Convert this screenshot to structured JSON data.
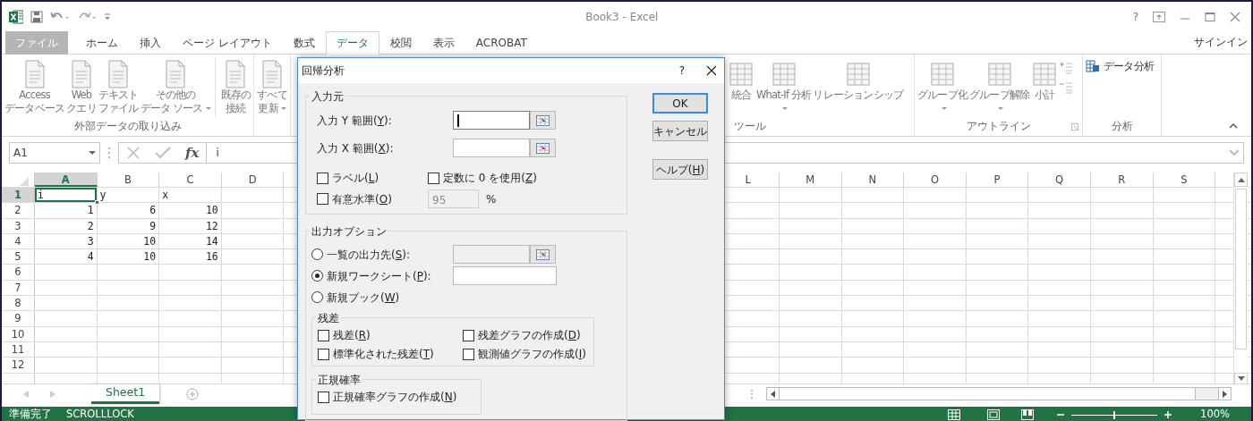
{
  "title_bar": {
    "title": "Book3 - Excel",
    "help": "?"
  },
  "ribbon_tabs": [
    {
      "label": "ファイル",
      "kind": "file",
      "selected": false
    },
    {
      "label": "ホーム",
      "kind": "tab",
      "selected": false
    },
    {
      "label": "挿入",
      "kind": "tab",
      "selected": false
    },
    {
      "label": "ページ レイアウト",
      "kind": "tab",
      "selected": false
    },
    {
      "label": "数式",
      "kind": "tab",
      "selected": false
    },
    {
      "label": "データ",
      "kind": "tab",
      "selected": true
    },
    {
      "label": "校閲",
      "kind": "tab",
      "selected": false
    },
    {
      "label": "表示",
      "kind": "tab",
      "selected": false
    },
    {
      "label": "ACROBAT",
      "kind": "tab",
      "selected": false
    }
  ],
  "account": "サインイン",
  "ribbon_groups": [
    {
      "label": "外部データの取り込み",
      "launcher": false,
      "buttons": [
        {
          "lines": [
            "Access",
            "データベース"
          ],
          "kind": "large",
          "dropdown": false,
          "separator_before": false
        },
        {
          "lines": [
            "Web",
            "クエリ"
          ],
          "kind": "large",
          "dropdown": false,
          "separator_before": false
        },
        {
          "lines": [
            "テキスト",
            "ファイル"
          ],
          "kind": "large",
          "dropdown": false,
          "separator_before": false
        },
        {
          "lines": [
            "その他の",
            "データ ソース"
          ],
          "kind": "large",
          "dropdown": true,
          "separator_before": false
        },
        {
          "lines": [
            "既存の",
            "接続"
          ],
          "kind": "large",
          "dropdown": false,
          "separator_before": true
        }
      ]
    },
    {
      "launcher": false,
      "buttons": [
        {
          "lines": [
            "すべて",
            "更新"
          ],
          "kind": "large",
          "dropdown": true,
          "separator_before": false
        }
      ]
    },
    {
      "label": "ツール",
      "launcher": false,
      "buttons": [
        {
          "lines": [
            "統合"
          ],
          "kind": "large",
          "dropdown": false,
          "separator_before": false
        },
        {
          "lines": [
            "What-If 分析"
          ],
          "kind": "large",
          "dropdown": true,
          "separator_before": false
        },
        {
          "lines": [
            "リレーションシップ"
          ],
          "kind": "large",
          "dropdown": false,
          "separator_before": false
        }
      ]
    },
    {
      "label": "アウトライン",
      "launcher": true,
      "buttons": [
        {
          "lines": [
            "グループ化"
          ],
          "kind": "large",
          "dropdown": true,
          "separator_before": false
        },
        {
          "lines": [
            "グループ解除"
          ],
          "kind": "large",
          "dropdown": true,
          "separator_before": false
        },
        {
          "lines": [
            "小計"
          ],
          "kind": "large",
          "dropdown": false,
          "separator_before": false
        },
        {
          "kind": "icon-stack"
        }
      ]
    },
    {
      "label": "分析",
      "launcher": false,
      "buttons": [
        {
          "lines": [
            "データ分析"
          ],
          "kind": "small",
          "dropdown": false,
          "separator_before": false
        }
      ]
    }
  ],
  "formula_bar": {
    "name_box": "A1",
    "fx": "fx",
    "formula": "i"
  },
  "columns": [
    {
      "label": "A",
      "selected": true
    },
    {
      "label": "B",
      "selected": false
    },
    {
      "label": "C",
      "selected": false
    },
    {
      "label": "D",
      "selected": false
    },
    {
      "label": "L",
      "selected": false
    },
    {
      "label": "M",
      "selected": false
    },
    {
      "label": "N",
      "selected": false
    },
    {
      "label": "O",
      "selected": false
    },
    {
      "label": "P",
      "selected": false
    },
    {
      "label": "Q",
      "selected": false
    },
    {
      "label": "R",
      "selected": false
    },
    {
      "label": "S",
      "selected": false
    }
  ],
  "rows": [
    {
      "header": "1",
      "selected": true,
      "cells": [
        {
          "text": "i",
          "kind": "text",
          "active": true
        },
        {
          "text": "y",
          "kind": "text",
          "active": false
        },
        {
          "text": "x",
          "kind": "text",
          "active": false
        }
      ]
    },
    {
      "header": "2",
      "selected": false,
      "cells": [
        {
          "text": "1",
          "kind": "number",
          "active": false
        },
        {
          "text": "6",
          "kind": "number",
          "active": false
        },
        {
          "text": "10",
          "kind": "number",
          "active": false
        }
      ]
    },
    {
      "header": "3",
      "selected": false,
      "cells": [
        {
          "text": "2",
          "kind": "number",
          "active": false
        },
        {
          "text": "9",
          "kind": "number",
          "active": false
        },
        {
          "text": "12",
          "kind": "number",
          "active": false
        }
      ]
    },
    {
      "header": "4",
      "selected": false,
      "cells": [
        {
          "text": "3",
          "kind": "number",
          "active": false
        },
        {
          "text": "10",
          "kind": "number",
          "active": false
        },
        {
          "text": "14",
          "kind": "number",
          "active": false
        }
      ]
    },
    {
      "header": "5",
      "selected": false,
      "cells": [
        {
          "text": "4",
          "kind": "number",
          "active": false
        },
        {
          "text": "10",
          "kind": "number",
          "active": false
        },
        {
          "text": "16",
          "kind": "number",
          "active": false
        }
      ]
    },
    {
      "header": "6",
      "selected": false,
      "cells": []
    },
    {
      "header": "7",
      "selected": false,
      "cells": []
    },
    {
      "header": "8",
      "selected": false,
      "cells": []
    },
    {
      "header": "9",
      "selected": false,
      "cells": []
    },
    {
      "header": "10",
      "selected": false,
      "cells": []
    },
    {
      "header": "11",
      "selected": false,
      "cells": []
    },
    {
      "header": "12",
      "selected": false,
      "cells": []
    }
  ],
  "sheet_tabs": [
    {
      "label": "Sheet1",
      "selected": true
    }
  ],
  "status_bar": {
    "ready": "準備完了",
    "scroll_lock": "SCROLLLOCK",
    "zoom": {
      "level": 0.5,
      "reading": "100%"
    }
  },
  "dialog": {
    "title": "回帰分析",
    "help": "?",
    "input_group": {
      "legend": "入力元",
      "ranges": [
        {
          "label": {
            "pre": "入力 Y 範囲(",
            "key": "Y",
            "post": "):"
          },
          "focused": true
        },
        {
          "label": {
            "pre": "入力 X 範囲(",
            "key": "X",
            "post": "):"
          },
          "focused": false
        }
      ],
      "options": [
        {
          "label": {
            "pre": "ラベル(",
            "key": "L",
            "post": ")"
          },
          "checked": false
        },
        {
          "label": {
            "pre": "定数に 0 を使用(",
            "key": "Z",
            "post": ")"
          },
          "checked": false
        },
        {
          "label": {
            "pre": "有意水準(",
            "key": "O",
            "post": ")"
          },
          "checked": false
        }
      ],
      "confidence": {
        "value": "95",
        "disabled": true,
        "unit": "%"
      }
    },
    "output_group": {
      "legend": "出力オプション",
      "destinations": [
        {
          "label": {
            "pre": "一覧の出力先(",
            "key": "S",
            "post": "):"
          },
          "selected": false,
          "field": {
            "kind": "range",
            "disabled": true
          }
        },
        {
          "label": {
            "pre": "新規ワークシート(",
            "key": "P",
            "post": "):"
          },
          "selected": true,
          "field": {
            "kind": "text",
            "disabled": false
          }
        },
        {
          "label": {
            "pre": "新規ブック(",
            "key": "W",
            "post": ")"
          },
          "selected": false
        }
      ],
      "residuals": {
        "legend": "残差",
        "options": [
          {
            "label": {
              "pre": "残差(",
              "key": "R",
              "post": ")"
            },
            "checked": false
          },
          {
            "label": {
              "pre": "残差グラフの作成(",
              "key": "D",
              "post": ")"
            },
            "checked": false
          },
          {
            "label": {
              "pre": "標準化された残差(",
              "key": "T",
              "post": ")"
            },
            "checked": false
          },
          {
            "label": {
              "pre": "観測値グラフの作成(",
              "key": "I",
              "post": ")"
            },
            "checked": false
          }
        ]
      },
      "normal": {
        "legend": "正規確率",
        "options": [
          {
            "label": {
              "pre": "正規確率グラフの作成(",
              "key": "N",
              "post": ")"
            },
            "checked": false
          }
        ]
      }
    },
    "buttons": [
      {
        "label": {
          "pre": "OK"
        },
        "default": true
      },
      {
        "label": {
          "pre": "キャンセル"
        },
        "default": false
      },
      {
        "label": {
          "pre": "ヘルプ(",
          "key": "H",
          "post": ")"
        },
        "default": false
      }
    ]
  }
}
